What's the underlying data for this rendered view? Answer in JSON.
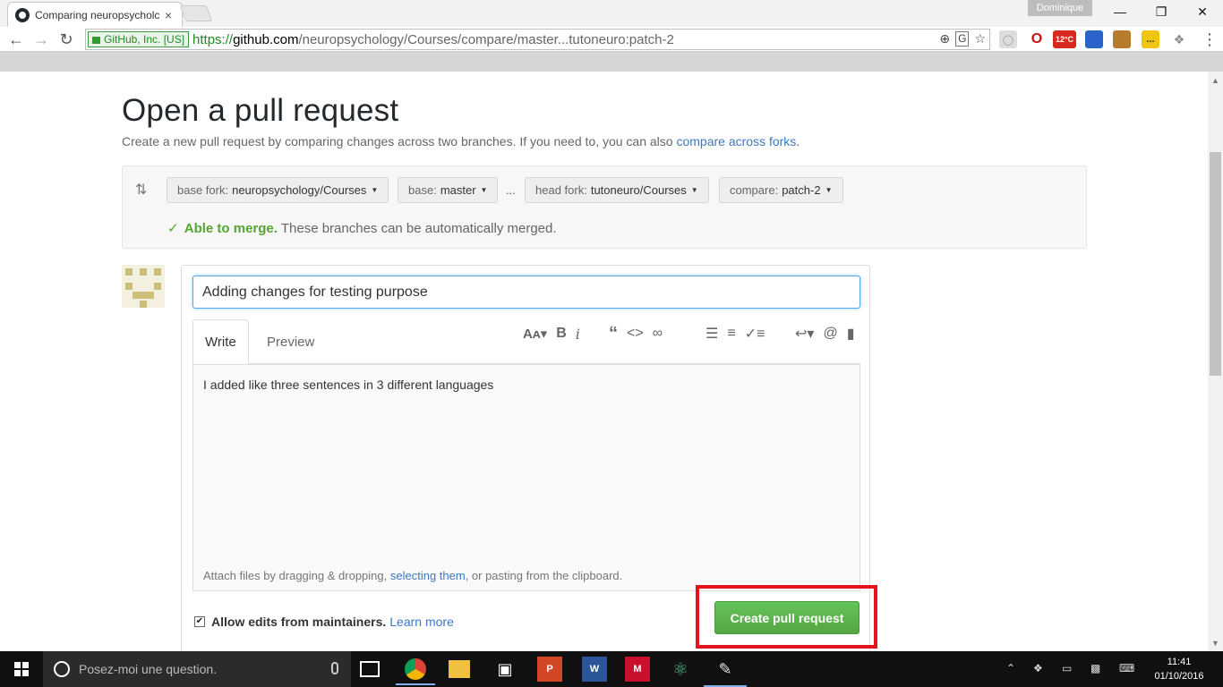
{
  "browser": {
    "tab_title": "Comparing neuropsycholc",
    "tab_close": "×",
    "profile_name": "Dominique",
    "window_controls": {
      "minimize": "—",
      "restore": "❐",
      "close": "✕"
    },
    "security_chip": "GitHub, Inc. [US]",
    "url_scheme": "https://",
    "url_host": "github.com",
    "url_path": "/neuropsychology/Courses/compare/master...tutoneuro:patch-2",
    "weather_badge": "12°C"
  },
  "page": {
    "title": "Open a pull request",
    "subtitle": "Create a new pull request by comparing changes across two branches. If you need to, you can also ",
    "subtitle_link": "compare across forks",
    "subtitle_end": "."
  },
  "compare": {
    "base_fork_label": "base fork:",
    "base_fork_value": "neuropsychology/Courses",
    "base_label": "base:",
    "base_value": "master",
    "ellipsis": "...",
    "head_fork_label": "head fork:",
    "head_fork_value": "tutoneuro/Courses",
    "compare_label": "compare:",
    "compare_value": "patch-2",
    "merge_ok": "Able to merge.",
    "merge_text": "These branches can be automatically merged."
  },
  "form": {
    "title_value": "Adding changes for testing purpose",
    "tab_write": "Write",
    "tab_preview": "Preview",
    "body_value": "I added like three sentences in 3 different languages",
    "attach_prefix": "Attach files by dragging & dropping, ",
    "attach_link": "selecting them",
    "attach_suffix": ", or pasting from the clipboard.",
    "allow_edits_label": "Allow edits from maintainers.",
    "learn_more": "Learn more",
    "submit_label": "Create pull request"
  },
  "taskbar": {
    "search_placeholder": "Posez-moi une question.",
    "time": "11:41",
    "date": "01/10/2016"
  },
  "colors": {
    "accent_green": "#55a532",
    "link_blue": "#4078c0",
    "highlight_red": "#e3141b",
    "focus_blue": "#51a7e8"
  }
}
